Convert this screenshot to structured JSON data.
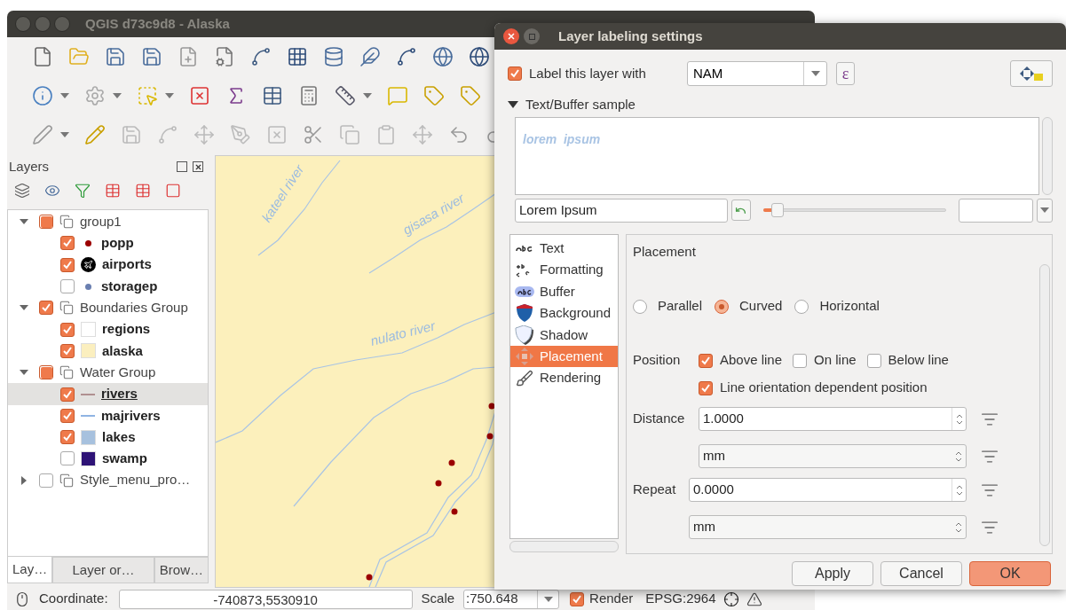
{
  "main_window": {
    "title": "QGIS d73c9d8 - Alaska"
  },
  "layers_panel": {
    "title": "Layers",
    "tree": [
      {
        "kind": "group",
        "label": "group1",
        "checked": false,
        "partial": true,
        "expanded": true,
        "selected": false,
        "children": [
          {
            "kind": "layer",
            "label": "popp",
            "checked": true,
            "symbol": {
              "kind": "dot",
              "color": "#9b0000"
            },
            "selected": false
          },
          {
            "kind": "layer",
            "label": "airports",
            "checked": true,
            "symbol": {
              "kind": "airport",
              "color": "#000000"
            },
            "selected": false
          },
          {
            "kind": "layer",
            "label": "storagep",
            "checked": false,
            "symbol": {
              "kind": "dot",
              "color": "#6a7fb0"
            },
            "selected": false
          }
        ]
      },
      {
        "kind": "group",
        "label": "Boundaries Group",
        "checked": true,
        "partial": false,
        "expanded": true,
        "selected": false,
        "children": [
          {
            "kind": "layer",
            "label": "regions",
            "checked": true,
            "symbol": {
              "kind": "fill",
              "color": "#ffffff"
            },
            "selected": false
          },
          {
            "kind": "layer",
            "label": "alaska",
            "checked": true,
            "symbol": {
              "kind": "fill",
              "color": "#fbefbf"
            },
            "selected": false
          }
        ]
      },
      {
        "kind": "group",
        "label": "Water Group",
        "checked": false,
        "partial": true,
        "expanded": true,
        "selected": false,
        "children": [
          {
            "kind": "layer",
            "label": "rivers",
            "checked": true,
            "symbol": {
              "kind": "line",
              "color": "#b09090"
            },
            "selected": true
          },
          {
            "kind": "layer",
            "label": "majrivers",
            "checked": true,
            "symbol": {
              "kind": "line",
              "color": "#8fb4e3"
            },
            "selected": false
          },
          {
            "kind": "layer",
            "label": "lakes",
            "checked": true,
            "symbol": {
              "kind": "fill",
              "color": "#a7c1de"
            },
            "selected": false
          },
          {
            "kind": "layer",
            "label": "swamp",
            "checked": false,
            "symbol": {
              "kind": "fill",
              "color": "#2e1376"
            },
            "selected": false
          }
        ]
      },
      {
        "kind": "group",
        "label": "Style_menu_pro…",
        "checked": false,
        "partial": false,
        "expanded": false,
        "selected": false
      }
    ],
    "tabs": [
      {
        "label": "Lay…",
        "selected": true
      },
      {
        "label": "Layer or…",
        "selected": false
      },
      {
        "label": "Brow…",
        "selected": false
      }
    ]
  },
  "map": {
    "labels": [
      {
        "text": "kateel river"
      },
      {
        "text": "gisasa river"
      },
      {
        "text": "nulato river"
      }
    ]
  },
  "status_bar": {
    "coordinate_label": "Coordinate:",
    "coordinate_value": "-740873,5530910",
    "scale_label": "Scale",
    "scale_value": ":750.648",
    "render": {
      "label": "Render",
      "checked": true
    },
    "crs": "EPSG:2964"
  },
  "dialog": {
    "title": "Layer labeling settings",
    "label_layer": {
      "label": "Label this layer with",
      "checked": true
    },
    "field_combo": {
      "value": "NAM"
    },
    "expression_button": "ε",
    "sample": {
      "label": "Text/Buffer sample",
      "expanded": true,
      "preview": "lorem  ipsum",
      "text_field": {
        "value": "Lorem Ipsum"
      },
      "size_slider": {
        "level": 0.08
      }
    },
    "categories": [
      {
        "label": "Text",
        "selected": false
      },
      {
        "label": "Formatting",
        "selected": false
      },
      {
        "label": "Buffer",
        "selected": false
      },
      {
        "label": "Background",
        "selected": false
      },
      {
        "label": "Shadow",
        "selected": false
      },
      {
        "label": "Placement",
        "selected": true
      },
      {
        "label": "Rendering",
        "selected": false
      }
    ],
    "placement": {
      "heading": "Placement",
      "modes": [
        {
          "label": "Parallel",
          "selected": false
        },
        {
          "label": "Curved",
          "selected": true
        },
        {
          "label": "Horizontal",
          "selected": false
        }
      ],
      "position_label": "Position",
      "position_options": [
        {
          "label": "Above line",
          "checked": true
        },
        {
          "label": "On line",
          "checked": false
        },
        {
          "label": "Below line",
          "checked": false
        }
      ],
      "orientation_option": {
        "label": "Line orientation dependent position",
        "checked": true
      },
      "distance": {
        "label": "Distance",
        "value": "1.0000",
        "unit": "mm"
      },
      "repeat": {
        "label": "Repeat",
        "value": "0.0000",
        "unit": "mm"
      }
    },
    "buttons": [
      {
        "label": "Apply",
        "kind": "normal"
      },
      {
        "label": "Cancel",
        "kind": "normal"
      },
      {
        "label": "OK",
        "kind": "primary"
      }
    ]
  }
}
